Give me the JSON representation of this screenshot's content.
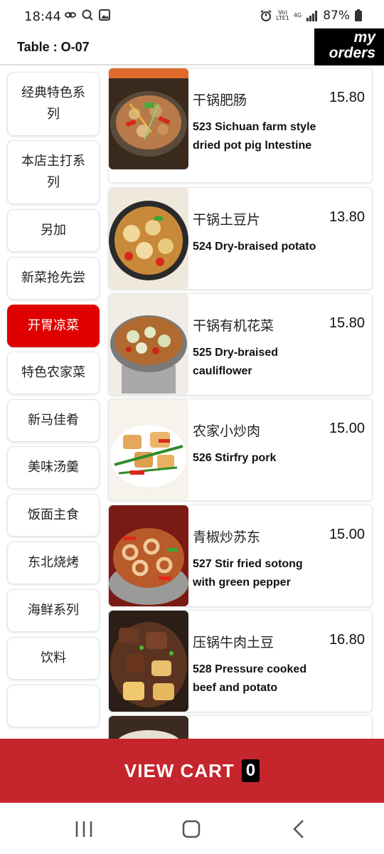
{
  "status_bar": {
    "time": "18:44",
    "battery": "87%",
    "network_top": "Vo)",
    "network_bottom": "LTE1",
    "network_type": "4G",
    "left_icons": [
      "link-icon",
      "search-icon",
      "image-icon"
    ],
    "right_icons": [
      "alarm-icon",
      "signal-icon",
      "battery-icon"
    ]
  },
  "header": {
    "table": "Table : O-07",
    "my_orders_line1": "my",
    "my_orders_line2": "orders"
  },
  "categories": [
    {
      "label": "经典特色系列",
      "active": false
    },
    {
      "label": "本店主打系列",
      "active": false
    },
    {
      "label": "另加",
      "active": false
    },
    {
      "label": "新菜抢先尝",
      "active": false
    },
    {
      "label": "开胃凉菜",
      "active": true
    },
    {
      "label": "特色农家菜",
      "active": false
    },
    {
      "label": "新马佳肴",
      "active": false
    },
    {
      "label": "美味汤羹",
      "active": false
    },
    {
      "label": "饭面主食",
      "active": false
    },
    {
      "label": "东北烧烤",
      "active": false
    },
    {
      "label": "海鲜系列",
      "active": false
    },
    {
      "label": "饮料",
      "active": false
    }
  ],
  "menu_items": [
    {
      "name_cn": "干锅肥肠",
      "name_en": "523 Sichuan farm style dried pot pig lntestine",
      "price": "15.80"
    },
    {
      "name_cn": "干锅土豆片",
      "name_en": "524 Dry-braised potato",
      "price": "13.80"
    },
    {
      "name_cn": "干锅有机花菜",
      "name_en": "525 Dry-braised cauliflower",
      "price": "15.80"
    },
    {
      "name_cn": "农家小炒肉",
      "name_en": "526 Stirfry pork",
      "price": "15.00"
    },
    {
      "name_cn": "青椒炒苏东",
      "name_en": "527 Stir fried sotong with green pepper",
      "price": "15.00"
    },
    {
      "name_cn": "压锅牛肉土豆",
      "name_en": "528 Pressure cooked beef and potato",
      "price": "16.80"
    }
  ],
  "cart": {
    "label": "VIEW CART",
    "count": "0"
  },
  "colors": {
    "accent": "#e00000",
    "cart_bar": "#c5252c",
    "my_orders_bg": "#000000"
  }
}
